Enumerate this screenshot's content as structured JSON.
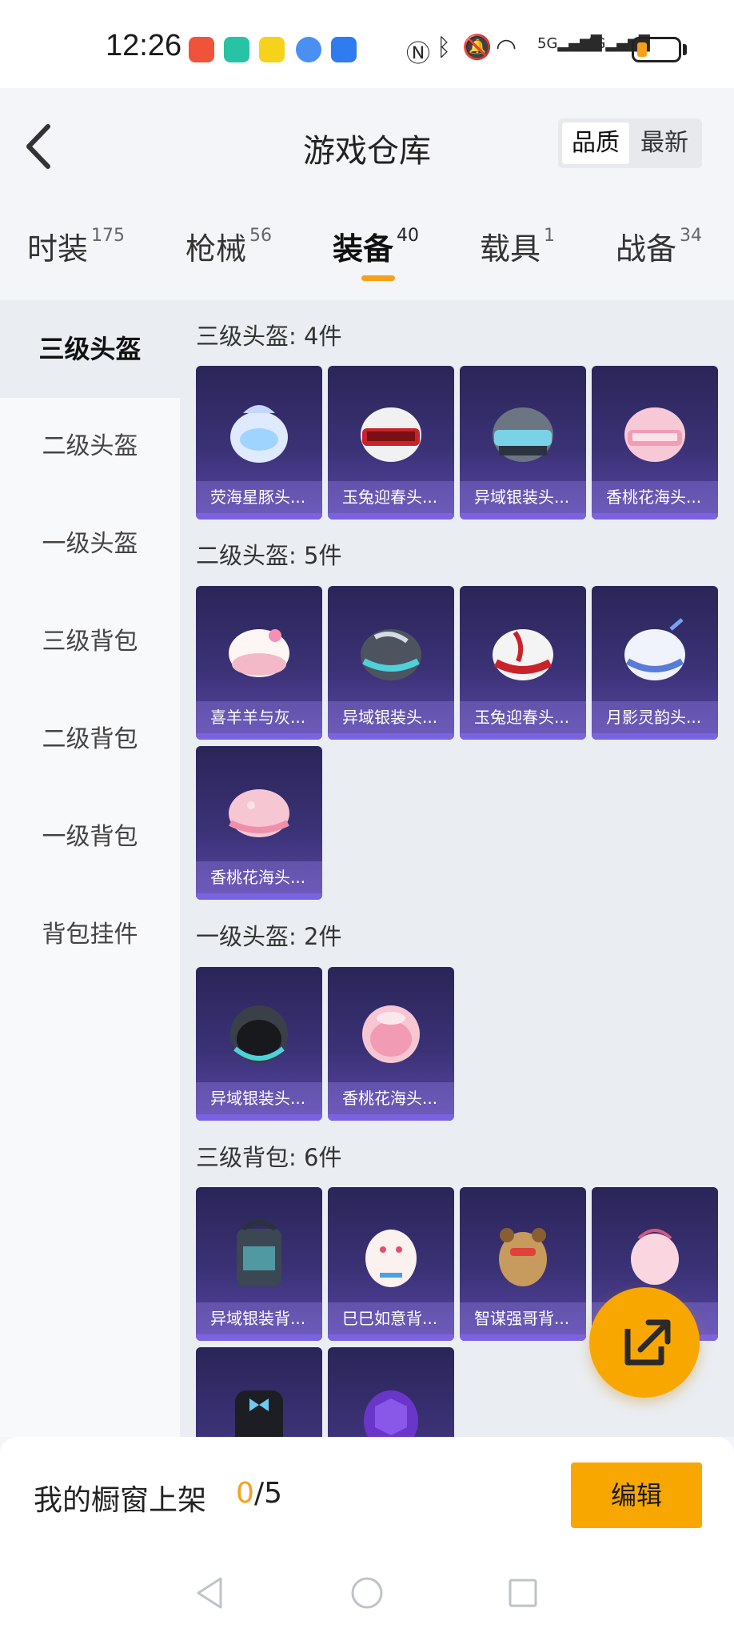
{
  "status_bar": {
    "time": "12:26",
    "network_5g": "5G",
    "network_4g": "4G"
  },
  "header": {
    "title": "游戏仓库",
    "sort_options": [
      "品质",
      "最新"
    ],
    "tabs": [
      {
        "label": "时装",
        "count": "175"
      },
      {
        "label": "枪械",
        "count": "56"
      },
      {
        "label": "装备",
        "count": "40"
      },
      {
        "label": "载具",
        "count": "1"
      },
      {
        "label": "战备",
        "count": "34"
      }
    ]
  },
  "sidebar": {
    "items": [
      "三级头盔",
      "二级头盔",
      "一级头盔",
      "三级背包",
      "二级背包",
      "一级背包",
      "背包挂件"
    ]
  },
  "sections": [
    {
      "title": "三级头盔: 4件",
      "items": [
        "荧海星豚头...",
        "玉兔迎春头...",
        "异域银装头...",
        "香桃花海头..."
      ]
    },
    {
      "title": "二级头盔: 5件",
      "items": [
        "喜羊羊与灰...",
        "异域银装头...",
        "玉兔迎春头...",
        "月影灵韵头...",
        "香桃花海头..."
      ]
    },
    {
      "title": "一级头盔: 2件",
      "items": [
        "异域银装头...",
        "香桃花海头..."
      ]
    },
    {
      "title": "三级背包: 6件",
      "items": [
        "异域银装背...",
        "巳巳如意背...",
        "智谋强哥背...",
        "",
        "",
        ""
      ]
    }
  ],
  "footer": {
    "label": "我的橱窗上架",
    "current": "0",
    "total": "/5",
    "edit_label": "编辑"
  },
  "colors": {
    "accent": "#f7a700",
    "card_bg": "#3b3276"
  }
}
